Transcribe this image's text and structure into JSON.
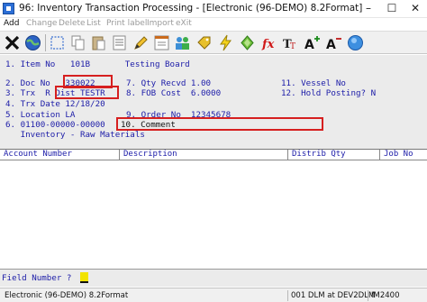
{
  "window": {
    "title": "96: Inventory Transaction Processing - [Electronic (96-DEMO) 8.2Format]",
    "minimize": "–",
    "maximize": "☐",
    "close": "✕"
  },
  "menu": [
    {
      "label": "Add",
      "enabled": true
    },
    {
      "label": "Change",
      "enabled": false
    },
    {
      "label": "Delete",
      "enabled": false
    },
    {
      "label": "List",
      "enabled": false
    },
    {
      "label": "Print label",
      "enabled": false
    },
    {
      "label": "Import",
      "enabled": false
    },
    {
      "label": "eXit",
      "enabled": false
    }
  ],
  "toolbar_icons": [
    "close-icon",
    "globe-icon",
    "select-icon",
    "copy-icon",
    "paste-icon",
    "list-icon",
    "pencil-icon",
    "form-icon",
    "people-icon",
    "tag-icon",
    "lightning-icon",
    "diamond-icon",
    "function-icon",
    "text-format-icon",
    "font-grow-icon",
    "font-shrink-icon",
    "help-icon"
  ],
  "form": {
    "line1_left": "1. Item No   101B       Testing Board",
    "line2_left": "2. Doc No   330022",
    "line2_mid": "7. Qty Recvd 1.00",
    "line2_right": "11. Vessel No",
    "line3_left": "3. Trx  R Dist TESTR",
    "line3_mid": "8. FOB Cost  6.0000",
    "line3_right": "12. Hold Posting? N",
    "line4_left": "4. Trx Date 12/18/20",
    "line5_left": "5. Location LA",
    "line5_mid": "9. Order No  12345678",
    "line6_left": "6. 01100-00000-00000",
    "line6_mid": "10. Comment",
    "line7_left": "   Inventory - Raw Materials"
  },
  "grid": {
    "columns": [
      "Account Number",
      "Description",
      "Distrib Qty",
      "Job No"
    ]
  },
  "field_prompt": "Field Number ?",
  "status": [
    "Electronic (96-DEMO) 8.2Format",
    "001 DLM at DEV2DLM",
    "IM2400"
  ],
  "colors": {
    "terminal_text": "#1c1ca8",
    "highlight_box": "#d61f1f",
    "cursor": "#f2e300"
  }
}
